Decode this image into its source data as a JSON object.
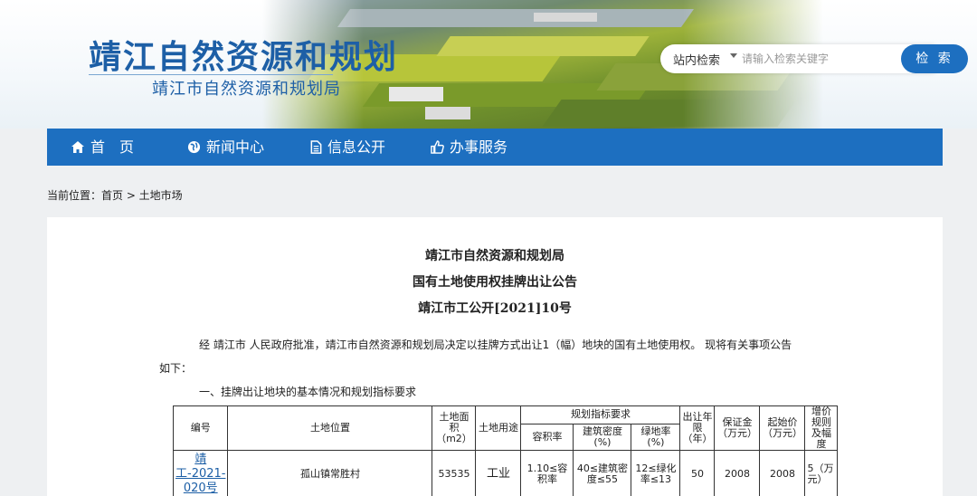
{
  "header": {
    "site_title": "靖江自然资源和规划",
    "site_subtitle": "靖江市自然资源和规划局"
  },
  "search": {
    "scope_label": "站内检索",
    "placeholder": "请输入检索关键字",
    "button_label": "检 索"
  },
  "nav": {
    "items": [
      {
        "label": "首　页",
        "icon": "home-icon"
      },
      {
        "label": "新闻中心",
        "icon": "globe-icon"
      },
      {
        "label": "信息公开",
        "icon": "document-icon"
      },
      {
        "label": "办事服务",
        "icon": "thumbs-up-icon"
      }
    ]
  },
  "breadcrumb": "当前位置：首页 > 土地市场",
  "article": {
    "title_1": "靖江市自然资源和规划局",
    "title_2": "国有土地使用权挂牌出让公告",
    "title_3": "靖江市工公开[2021]10号",
    "intro_line_1": "经 靖江市 人民政府批准，靖江市自然资源和规划局决定以挂牌方式出让1（幅）地块的国有土地使用权。 现将有关事项公告",
    "intro_line_2": "如下：",
    "section_1": "一、挂牌出让地块的基本情况和规划指标要求"
  },
  "table": {
    "headers": {
      "code": "编号",
      "location": "土地位置",
      "area": "土地面积（m2）",
      "usage": "土地用途",
      "planning": "规划指标要求",
      "plot_ratio": "容积率",
      "density": "建筑密度(%)",
      "green": "绿地率(%)",
      "term": "出让年限（年）",
      "deposit": "保证金（万元）",
      "start_price": "起始价（万元）",
      "increment": "增价规则及幅度"
    },
    "rows": [
      {
        "code": "靖工-2021-020号",
        "location": "孤山镇常胜村",
        "area": "53535",
        "usage": "工业",
        "plot_ratio": "1.10≤容积率",
        "density": "40≤建筑密度≤55",
        "green": "12≤绿化率≤13",
        "term": "50",
        "deposit": "2008",
        "start_price": "2008",
        "increment": "5（万元）"
      }
    ]
  }
}
